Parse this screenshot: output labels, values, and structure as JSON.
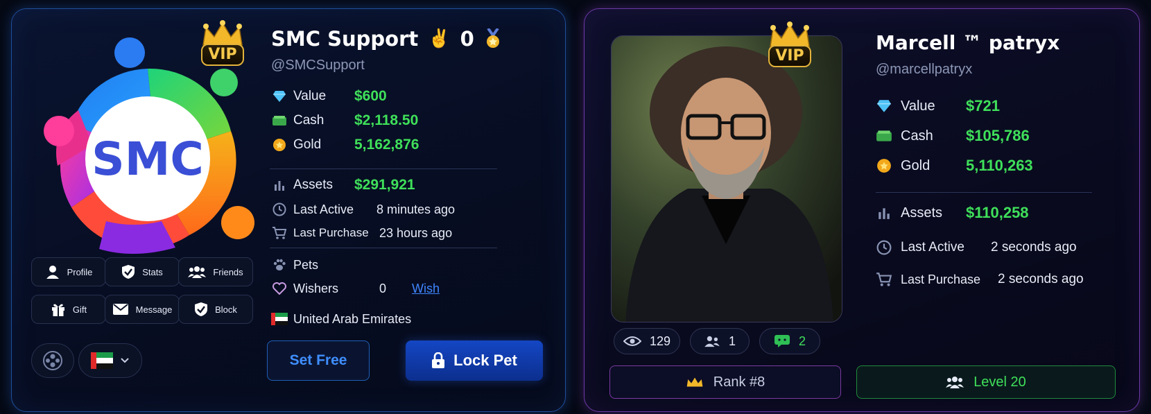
{
  "left_card": {
    "name": "SMC Support",
    "badge_emoji": "✌️",
    "badge_count": "0",
    "handle": "@SMCSupport",
    "vip_label": "VIP",
    "logo_text": "SMC",
    "stats": {
      "value_label": "Value",
      "value": "$600",
      "cash_label": "Cash",
      "cash": "$2,118.50",
      "gold_label": "Gold",
      "gold": "5,162,876",
      "assets_label": "Assets",
      "assets": "$291,921",
      "last_active_label": "Last Active",
      "last_active": "8 minutes ago",
      "last_purchase_label": "Last Purchase",
      "last_purchase": "23 hours ago"
    },
    "pets_label": "Pets",
    "wishers_label": "Wishers",
    "wishers_count": "0",
    "wish_link": "Wish",
    "country": "United Arab Emirates",
    "buttons": {
      "profile": "Profile",
      "stats": "Stats",
      "friends": "Friends",
      "gift": "Gift",
      "message": "Message",
      "block": "Block"
    },
    "set_free": "Set Free",
    "lock_pet": "Lock Pet",
    "colors": {
      "accent_green": "#3fe05a",
      "border": "#1e4f9c",
      "lock_bg": "#0f3a9e"
    }
  },
  "right_card": {
    "name": "Marcell ™ patryx",
    "handle": "@marcellpatryx",
    "vip_label": "VIP",
    "stats": {
      "value_label": "Value",
      "value": "$721",
      "cash_label": "Cash",
      "cash": "$105,786",
      "gold_label": "Gold",
      "gold": "5,110,263",
      "assets_label": "Assets",
      "assets": "$110,258",
      "last_active_label": "Last Active",
      "last_active": "2 seconds ago",
      "last_purchase_label": "Last Purchase",
      "last_purchase": "2 seconds ago"
    },
    "views": "129",
    "friends": "1",
    "messages": "2",
    "rank": "Rank #8",
    "level": "Level 20",
    "colors": {
      "border": "#6d3aa8",
      "rank_border": "#7a3aa0",
      "level_border": "#1f8a3c"
    }
  }
}
